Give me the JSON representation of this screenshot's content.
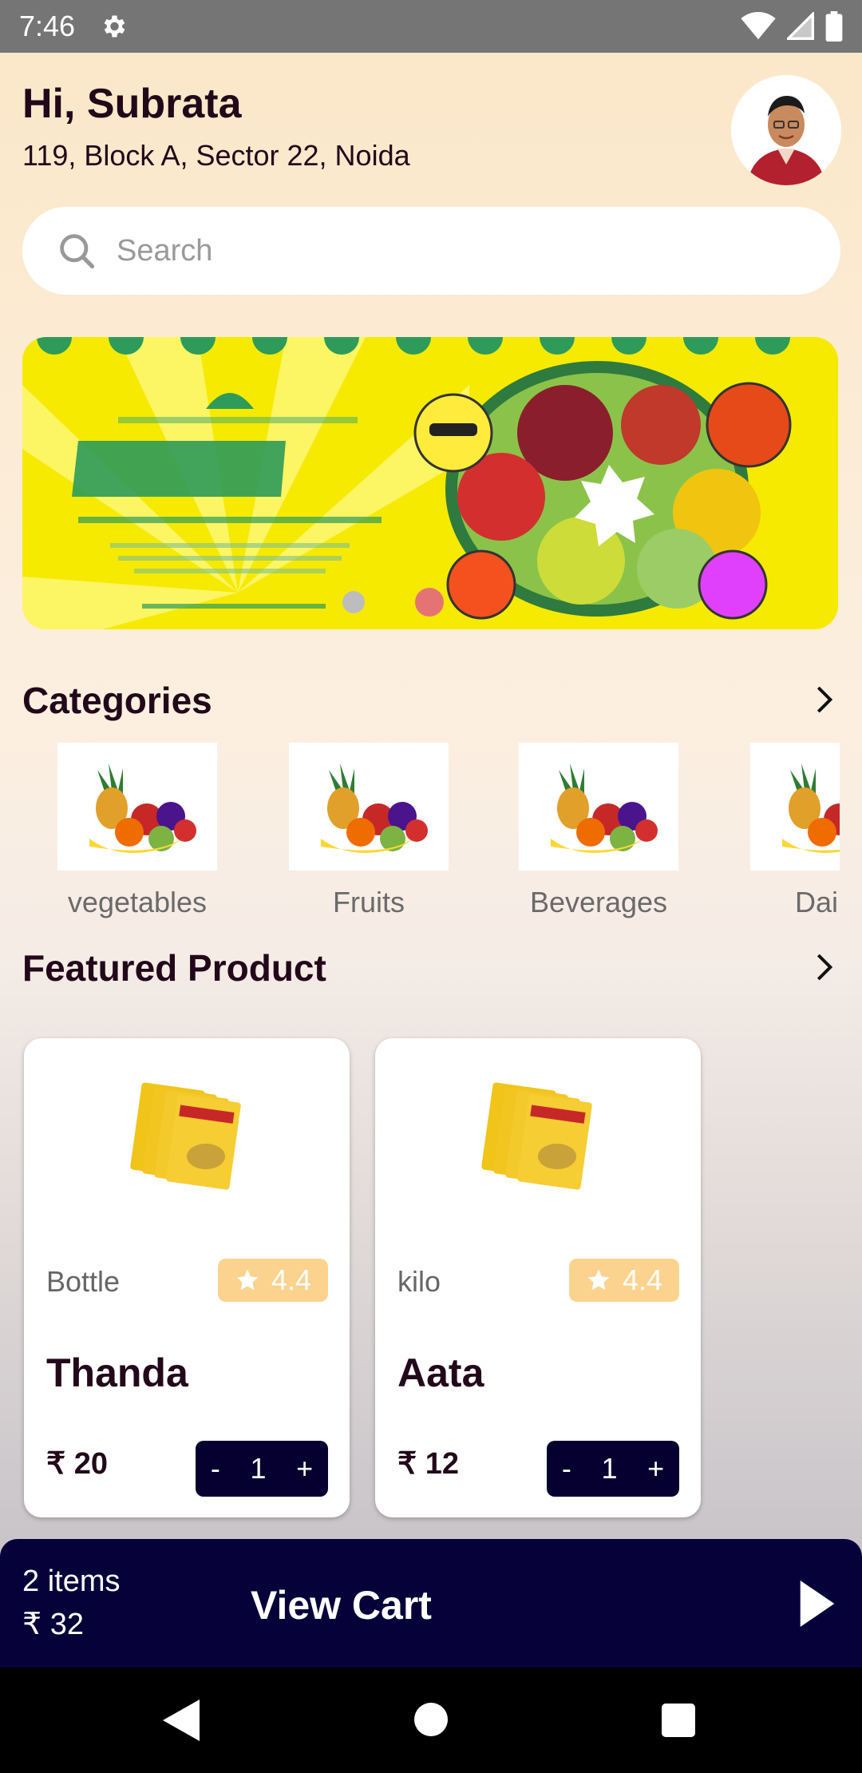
{
  "status_bar": {
    "time": "7:46",
    "icons": [
      "gear-icon",
      "wifi-icon",
      "signal-icon",
      "battery-icon"
    ]
  },
  "header": {
    "greeting": "Hi, Subrata",
    "address": "119, Block A, Sector 22, Noida"
  },
  "search": {
    "placeholder": "Search"
  },
  "categories": {
    "title": "Categories",
    "items": [
      {
        "label": "vegetables"
      },
      {
        "label": "Fruits"
      },
      {
        "label": "Beverages"
      },
      {
        "label": "Dai"
      }
    ]
  },
  "featured": {
    "title": "Featured Product",
    "products": [
      {
        "unit": "Bottle",
        "rating": "4.4",
        "name": "Thanda",
        "price": "₹ 20",
        "minus": "-",
        "qty": "1",
        "plus": "+"
      },
      {
        "unit": "kilo",
        "rating": "4.4",
        "name": "Aata",
        "price": "₹ 12",
        "minus": "-",
        "qty": "1",
        "plus": "+"
      }
    ]
  },
  "cart": {
    "items": "2 items",
    "total": "₹ 32",
    "label": "View Cart"
  },
  "colors": {
    "accent_dark": "#07013a",
    "rating_badge": "#fbd38f",
    "banner_yellow": "#f6ea00"
  }
}
